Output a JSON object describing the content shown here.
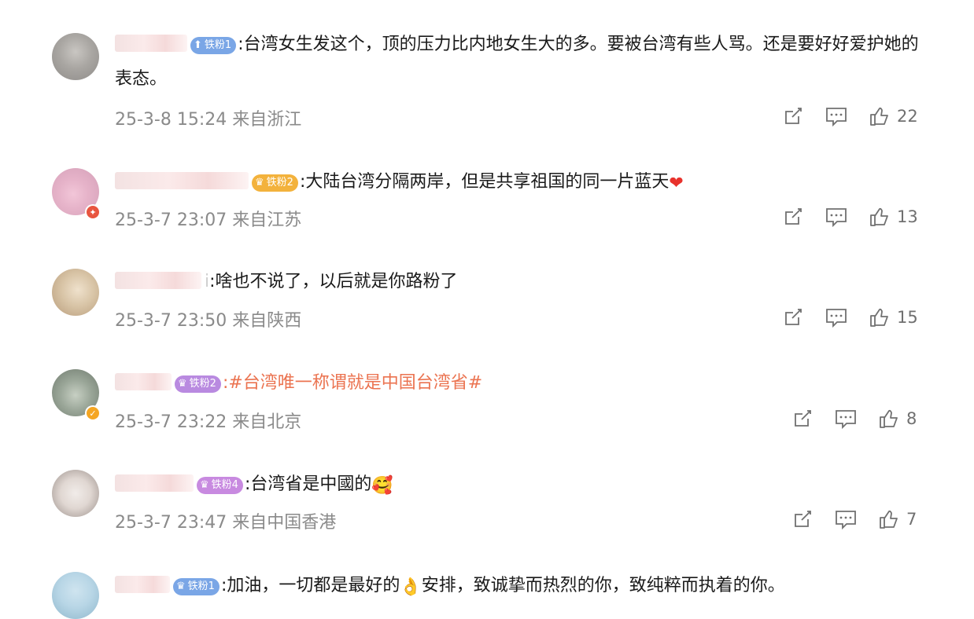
{
  "comments": [
    {
      "badge_text": "铁粉1",
      "badge_icon": "⬆",
      "badge_color": "#7aa6e6",
      "text": ":台湾女生发这个，顶的压力比内地女生大的多。要被台湾有些人骂。还是要好好爱护她的表态。",
      "time": "25-3-8 15:24 来自浙江",
      "likes": "22"
    },
    {
      "badge_text": "铁粉2",
      "badge_icon": "♛",
      "badge_color": "#f3b23c",
      "text": ":大陆台湾分隔两岸，但是共享祖国的同一片蓝天",
      "emoji": "❤",
      "time": "25-3-7 23:07 来自江苏",
      "likes": "13"
    },
    {
      "name_tail": "i",
      "text": ":啥也不说了，以后就是你路粉了",
      "time": "25-3-7 23:50 来自陕西",
      "likes": "15"
    },
    {
      "badge_text": "铁粉2",
      "badge_icon": "♛",
      "badge_color": "#b98ae0",
      "text": ":#台湾唯一称谓就是中国台湾省#",
      "time": "25-3-7 23:22 来自北京",
      "likes": "8"
    },
    {
      "badge_text": "铁粉4",
      "badge_icon": "♛",
      "badge_color": "#c88ae0",
      "text": ":台湾省是中國的",
      "emoji": "🥰",
      "time": "25-3-7 23:47 来自中国香港",
      "likes": "7"
    },
    {
      "badge_text": "铁粉1",
      "badge_icon": "♛",
      "badge_color": "#7aa6e6",
      "text_a": ":加油，一切都是最好的",
      "emoji": "👌",
      "text_b": "安排，致诚挚而热烈的你，致纯粹而执着的你。"
    }
  ],
  "colors": {
    "meta": "#8a8a8a",
    "topic": "#eb7350",
    "icon": "#707070"
  }
}
